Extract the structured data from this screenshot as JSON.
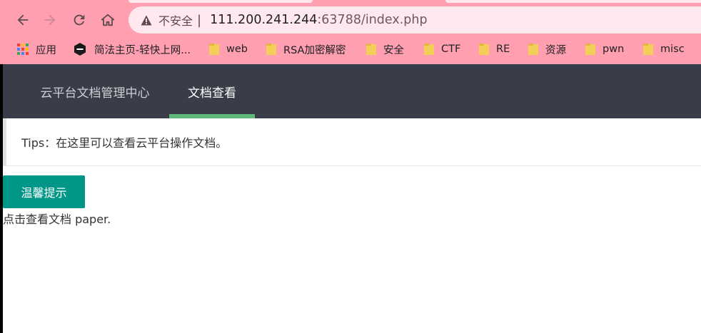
{
  "browser": {
    "address": {
      "security_label": "不安全",
      "separator": "|",
      "host": "111.200.241.244",
      "path": ":63788/index.php"
    },
    "bookmarks": [
      {
        "label": "应用",
        "icon": "apps-grid-icon"
      },
      {
        "label": "简法主页-轻快上网...",
        "icon": "hexagon-site-icon"
      },
      {
        "label": "web",
        "icon": "folder-icon"
      },
      {
        "label": "RSA加密解密",
        "icon": "folder-icon"
      },
      {
        "label": "安全",
        "icon": "folder-icon"
      },
      {
        "label": "CTF",
        "icon": "folder-icon"
      },
      {
        "label": "RE",
        "icon": "folder-icon"
      },
      {
        "label": "资源",
        "icon": "folder-icon"
      },
      {
        "label": "pwn",
        "icon": "folder-icon"
      },
      {
        "label": "misc",
        "icon": "folder-icon"
      }
    ],
    "colors": {
      "chrome_bg": "#ff9fb0",
      "omnibox_bg": "#ffe8ee"
    }
  },
  "app": {
    "nav": {
      "items": [
        {
          "label": "云平台文档管理中心",
          "active": false
        },
        {
          "label": "文档查看",
          "active": true
        }
      ]
    },
    "tips": "Tips：在这里可以查看云平台操作文档。",
    "hint_button": "温馨提示",
    "doc_line": "点击查看文档 paper.",
    "colors": {
      "nav_bg": "#393d49",
      "nav_active_bar": "#5fb878",
      "button_bg": "#009688"
    }
  }
}
